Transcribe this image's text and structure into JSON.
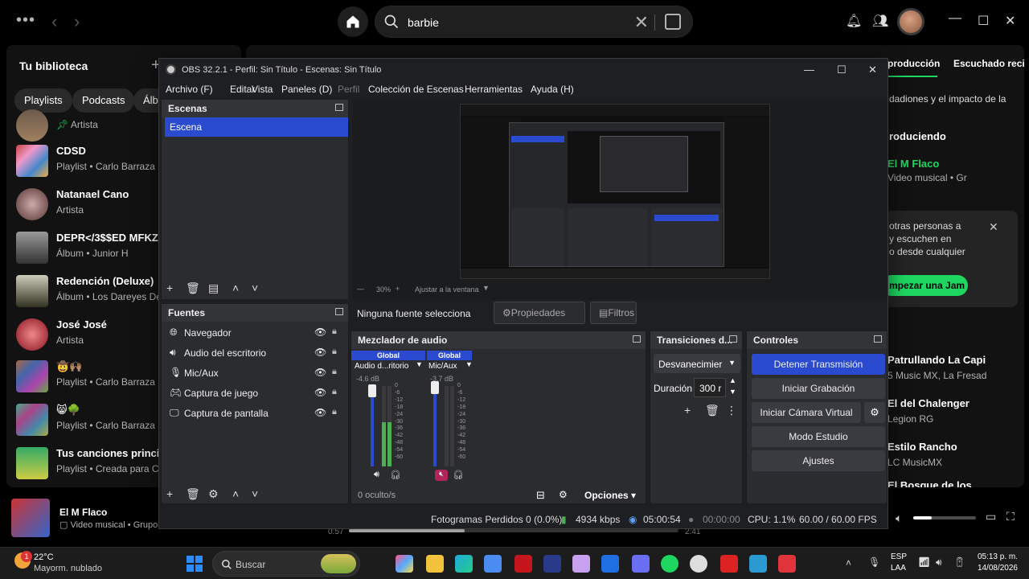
{
  "spotify": {
    "search": {
      "value": "barbie"
    },
    "library": {
      "title": "Tu biblioteca",
      "chips": [
        "Playlists",
        "Podcasts",
        "Álbu"
      ],
      "items": [
        {
          "name": "",
          "sub": "Artista"
        },
        {
          "name": "CDSD",
          "sub": "Playlist • Carlo Barraza"
        },
        {
          "name": "Natanael Cano",
          "sub": "Artista"
        },
        {
          "name": "DEPR</3$$ED MFKZ",
          "sub": "Álbum • Junior H"
        },
        {
          "name": "Redención (Deluxe)",
          "sub": "Álbum • Los Dareyes De"
        },
        {
          "name": "José José",
          "sub": "Artista"
        },
        {
          "name": "🤠🙌🏽",
          "sub": "Playlist • Carlo Barraza"
        },
        {
          "name": "😸🌳",
          "sub": "Playlist • Carlo Barraza"
        },
        {
          "name": "Tus canciones princip",
          "sub": "Playlist • Creada para Ca"
        }
      ]
    },
    "right_panel": {
      "tab_active": "producción",
      "tab_other": "Escuchado recien",
      "desc": "dadiones y el impacto de la",
      "reproduciendo_label": "roduciendo",
      "artist": "El M Flaco",
      "artist_sub": "Video musical • Gr",
      "jam_lines": [
        "otras personas a",
        "y escuchen en",
        "o desde cualquier"
      ],
      "jam_button": "mpezar una Jam",
      "songs": [
        {
          "title": "Patrullando La Capi",
          "sub": "5 Music MX, La Fresad"
        },
        {
          "title": "El del Chalenger",
          "sub": "Legion RG"
        },
        {
          "title": "Estilo Rancho",
          "sub": "LC MusicMX"
        },
        {
          "title": "El Bosque de los",
          "sub": ""
        }
      ]
    },
    "player": {
      "title": "El M Flaco",
      "sub": "Video musical • Grupo F",
      "elapsed": "0:57",
      "total": "2:41",
      "progress": 0.35,
      "volume": 0.3
    }
  },
  "obs": {
    "title": "OBS 32.2.1 - Perfil: Sin Título - Escenas: Sin Título",
    "menu": [
      "Archivo (F)",
      "Editar",
      "Vista",
      "Paneles (D)",
      "Perfil",
      "Colección de Escenas",
      "Herramientas",
      "Ayuda (H)"
    ],
    "scenes": {
      "header": "Escenas",
      "items": [
        "Escena"
      ]
    },
    "sources": {
      "header": "Fuentes",
      "items": [
        {
          "name": "Navegador",
          "icon": "globe-icon"
        },
        {
          "name": "Audio del escritorio",
          "icon": "speaker-icon"
        },
        {
          "name": "Mic/Aux",
          "icon": "mic-icon"
        },
        {
          "name": "Captura de juego",
          "icon": "gamepad-icon"
        },
        {
          "name": "Captura de pantalla",
          "icon": "monitor-icon"
        }
      ]
    },
    "preview": {
      "zoom": "30%",
      "fit": "Ajustar a la ventana"
    },
    "no_source": "Ninguna fuente selecciona",
    "properties": "Propiedades",
    "filters": "Filtros",
    "mixer": {
      "header": "Mezclador de audio",
      "channels": [
        {
          "tag": "Global",
          "name": "Audio d...ritorio",
          "db": "-4.6 dB",
          "level": 0.55
        },
        {
          "tag": "Global",
          "name": "Mic/Aux",
          "db": "-3.7 dB",
          "level": 0.0
        }
      ],
      "ticks": [
        "0",
        "-6",
        "-12",
        "-18",
        "-24",
        "-30",
        "-36",
        "-42",
        "-48",
        "-54",
        "-60"
      ],
      "hidden": "0 oculto/s",
      "options": "Opciones"
    },
    "transitions": {
      "header": "Transiciones d...",
      "selected": "Desvanecimier",
      "duration_label": "Duración",
      "duration_value": "300 r"
    },
    "controls": {
      "header": "Controles",
      "stop_stream": "Detener Transmisión",
      "start_record": "Iniciar Grabación",
      "virtual_cam": "Iniciar Cámara Virtual",
      "studio": "Modo Estudio",
      "settings": "Ajustes"
    },
    "status": {
      "dropped": "Fotogramas Perdidos 0 (0.0%)",
      "bitrate": "4934 kbps",
      "stream_time": "05:00:54",
      "rec_time": "00:00:00",
      "cpu": "CPU: 1.1%",
      "fps": "60.00 / 60.00 FPS"
    }
  },
  "taskbar": {
    "weather_temp": "22°C",
    "weather_desc": "Mayorm. nublado",
    "search": "Buscar",
    "lang": "ESP",
    "lang2": "LAA",
    "time": "05:13 p. m.",
    "date": "14/08/2026",
    "badge": "1"
  },
  "colors": {
    "accent": "#2a4bd0",
    "spotify_green": "#1ed760"
  }
}
